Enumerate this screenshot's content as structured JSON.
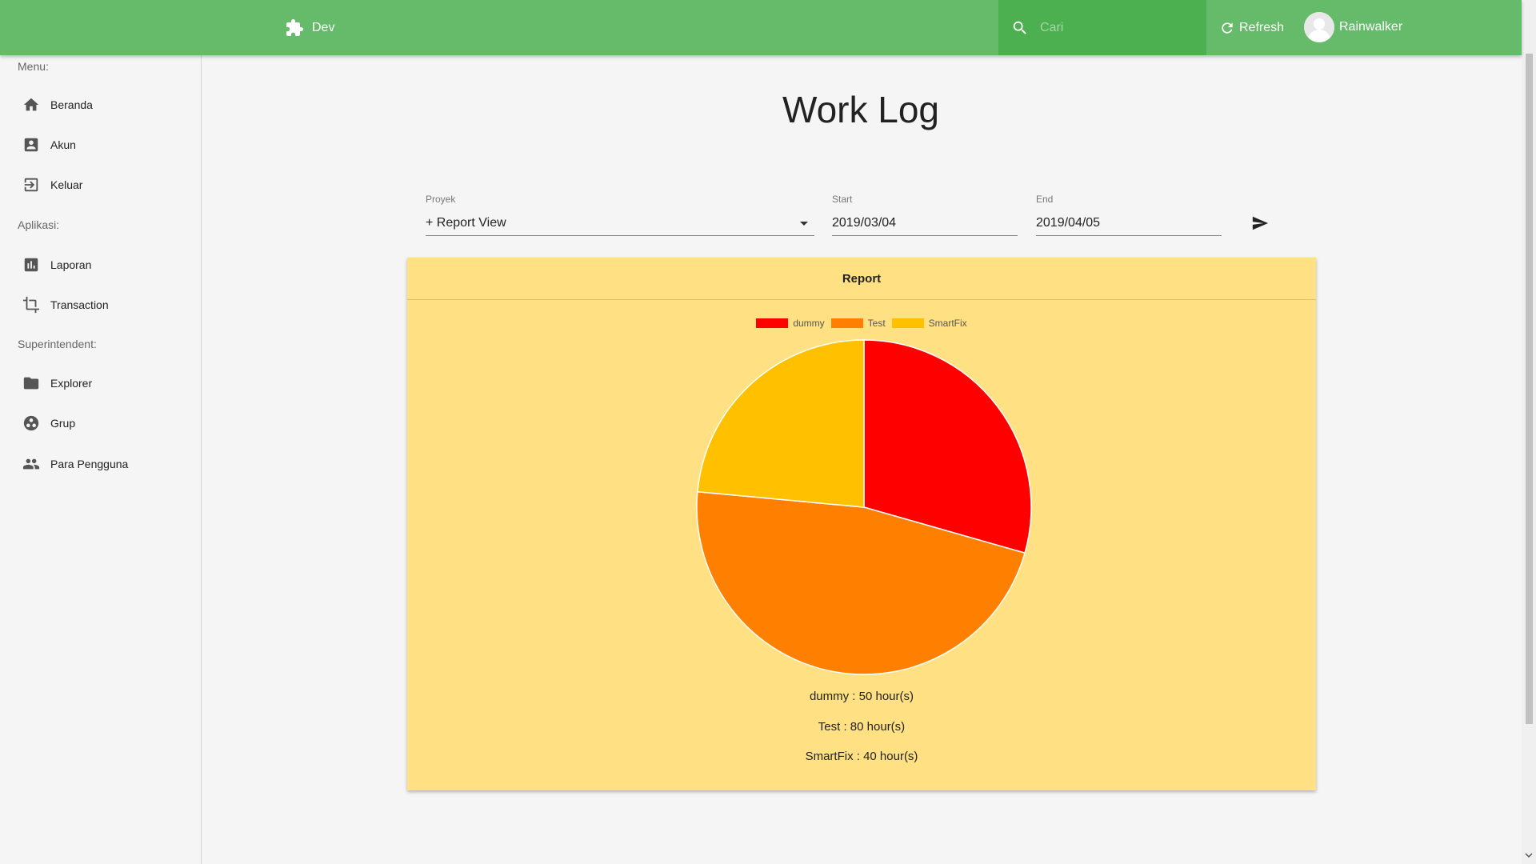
{
  "header": {
    "app_name": "Dev",
    "search_placeholder": "Cari",
    "refresh_label": "Refresh",
    "user_name": "Rainwalker",
    "bar_color": "#66bb6a",
    "search_bg": "#4caf50"
  },
  "sidebar": {
    "sections": [
      {
        "label": "Menu:",
        "items": [
          {
            "label": "Beranda",
            "icon": "home-icon"
          },
          {
            "label": "Akun",
            "icon": "account-box-icon"
          },
          {
            "label": "Keluar",
            "icon": "exit-icon"
          }
        ]
      },
      {
        "label": "Aplikasi:",
        "items": [
          {
            "label": "Laporan",
            "icon": "bar-chart-icon"
          },
          {
            "label": "Transaction",
            "icon": "crop-icon"
          }
        ]
      },
      {
        "label": "Superintendent:",
        "items": [
          {
            "label": "Explorer",
            "icon": "folder-icon"
          },
          {
            "label": "Grup",
            "icon": "group-work-icon"
          },
          {
            "label": "Para Pengguna",
            "icon": "people-icon"
          }
        ]
      }
    ]
  },
  "main": {
    "title": "Work Log",
    "filters": {
      "project_label": "Proyek",
      "project_value": "+ Report View",
      "start_label": "Start",
      "start_value": "2019/03/04",
      "end_label": "End",
      "end_value": "2019/04/05"
    },
    "report": {
      "title": "Report",
      "summary": [
        "dummy : 50 hour(s)",
        "Test : 80 hour(s)",
        "SmartFix : 40 hour(s)"
      ]
    }
  },
  "chart_data": {
    "type": "pie",
    "title": "",
    "categories": [
      "dummy",
      "Test",
      "SmartFix"
    ],
    "values": [
      50,
      80,
      40
    ],
    "colors": [
      "#ff0000",
      "#ff8000",
      "#ffc000"
    ],
    "legend": "top"
  }
}
